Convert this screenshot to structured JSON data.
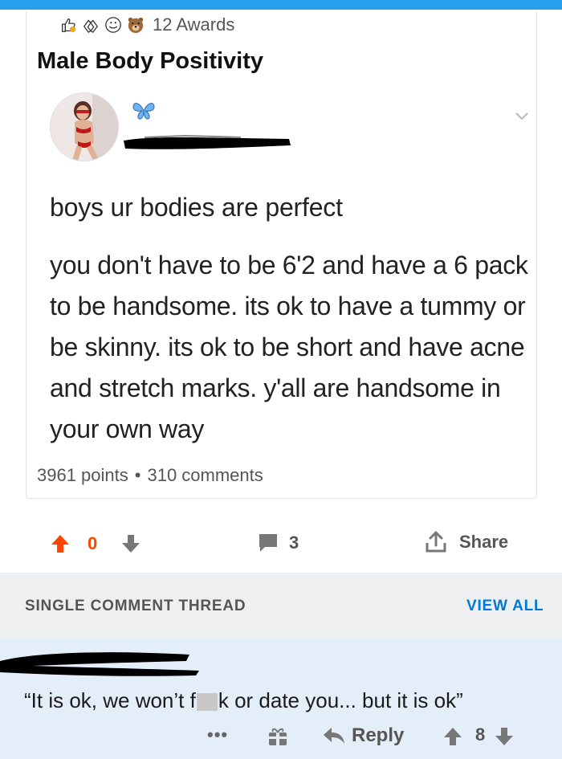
{
  "awards": {
    "icons": [
      "thumbs-up-award-icon",
      "hands-award-icon",
      "smile-award-icon",
      "bear-award-icon"
    ],
    "count_label": "12 Awards"
  },
  "post": {
    "title": "Male Body Positivity"
  },
  "tweet": {
    "first_line": "boys ur bodies are perfect",
    "body": "you don't have to be 6'2 and have a 6 pack to be handsome. its ok to have a tummy or be skinny. its ok to be short and have acne and stretch marks. y'all are handsome in your own way"
  },
  "meta": {
    "points": "3961 points",
    "separator": "•",
    "comments": "310 comments"
  },
  "actions": {
    "vote_count": "0",
    "comment_count": "3",
    "share_label": "Share"
  },
  "thread": {
    "label": "SINGLE COMMENT THREAD",
    "view_all": "VIEW ALL"
  },
  "comment": {
    "text_before": "“It is ok, we won’t f",
    "text_after": "k or date you... but it is ok”",
    "more": "•••",
    "reply_label": "Reply",
    "score": "8"
  },
  "colors": {
    "accent_blue": "#24a0ed",
    "upvote_orange": "#ff4500",
    "link_blue": "#0079d3",
    "comment_bg": "#e4eef8"
  }
}
